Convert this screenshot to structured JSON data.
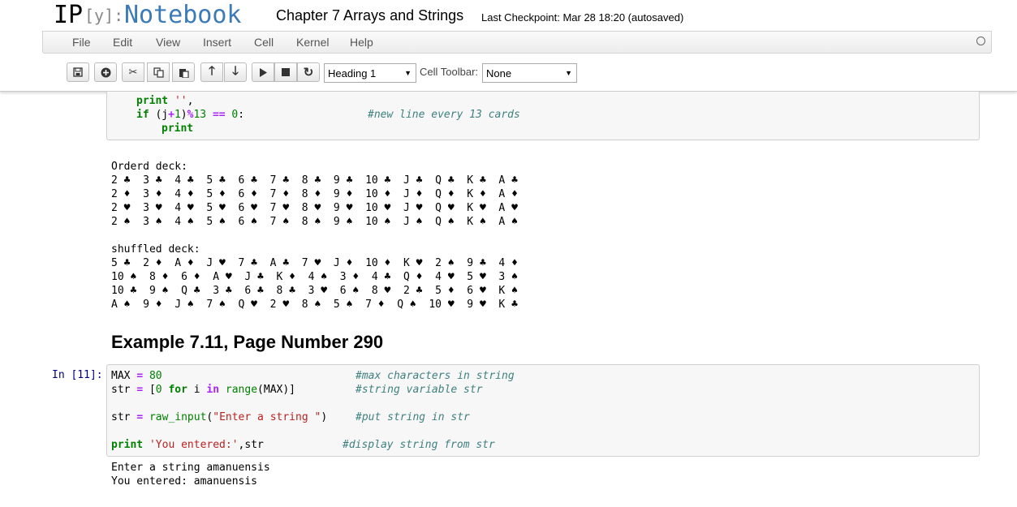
{
  "header": {
    "logo_ip": "IP",
    "logo_y": "[y]:",
    "logo_nb": "Notebook",
    "title": "Chapter 7 Arrays and Strings",
    "checkpoint": "Last Checkpoint: Mar 28 18:20 (autosaved)"
  },
  "menu": [
    "File",
    "Edit",
    "View",
    "Insert",
    "Cell",
    "Kernel",
    "Help"
  ],
  "toolbar": {
    "cell_type": "Heading 1",
    "cell_toolbar_label": "Cell Toolbar:",
    "cell_toolbar_value": "None"
  },
  "cell1_lines": [
    [
      "print '',",
      ""
    ],
    [
      "if (j+1)%13 == 0:",
      "#new line every 13 cards"
    ],
    [
      "print",
      ""
    ]
  ],
  "output1": {
    "ordered_header": "Orderd deck:",
    "ordered": [
      "2 ♣  3 ♣  4 ♣  5 ♣  6 ♣  7 ♣  8 ♣  9 ♣  10 ♣  J ♣  Q ♣  K ♣  A ♣",
      "2 ♦  3 ♦  4 ♦  5 ♦  6 ♦  7 ♦  8 ♦  9 ♦  10 ♦  J ♦  Q ♦  K ♦  A ♦",
      "2 ♥  3 ♥  4 ♥  5 ♥  6 ♥  7 ♥  8 ♥  9 ♥  10 ♥  J ♥  Q ♥  K ♥  A ♥",
      "2 ♠  3 ♠  4 ♠  5 ♠  6 ♠  7 ♠  8 ♠  9 ♠  10 ♠  J ♠  Q ♠  K ♠  A ♠"
    ],
    "shuffled_header": "shuffled deck:",
    "shuffled": [
      "5 ♣  2 ♦  A ♦  J ♥  7 ♣  A ♣  7 ♥  J ♦  10 ♦  K ♥  2 ♠  9 ♣  4 ♦",
      "10 ♠  8 ♦  6 ♦  A ♥  J ♣  K ♦  4 ♠  3 ♦  4 ♣  Q ♦  4 ♥  5 ♥  3 ♠",
      "10 ♣  9 ♠  Q ♣  3 ♣  6 ♣  8 ♣  3 ♥  6 ♠  8 ♥  2 ♣  5 ♦  6 ♥  K ♠",
      "A ♠  9 ♦  J ♠  7 ♠  Q ♥  2 ♥  8 ♠  5 ♠  7 ♦  Q ♠  10 ♥  9 ♥  K ♣"
    ]
  },
  "heading": "Example 7.11, Page Number 290",
  "cell2": {
    "prompt": "In [11]:",
    "l1_code": "MAX = 80",
    "l1_comment": "#max characters in string",
    "l2_code": "str = [0 for i in range(MAX)]",
    "l2_comment": "#string variable str",
    "l3_code": "str = raw_input(\"Enter a string \")",
    "l3_comment": "#put string in str",
    "l4_code": "print 'You entered:',str",
    "l4_comment": "#display string from str"
  },
  "output2": [
    "Enter a string amanuensis",
    "You entered: amanuensis"
  ],
  "colors": {
    "accent": "#3c7ab8",
    "prompt": "#000080",
    "keyword": "#008000",
    "string": "#ba2121",
    "comment": "#408080"
  }
}
